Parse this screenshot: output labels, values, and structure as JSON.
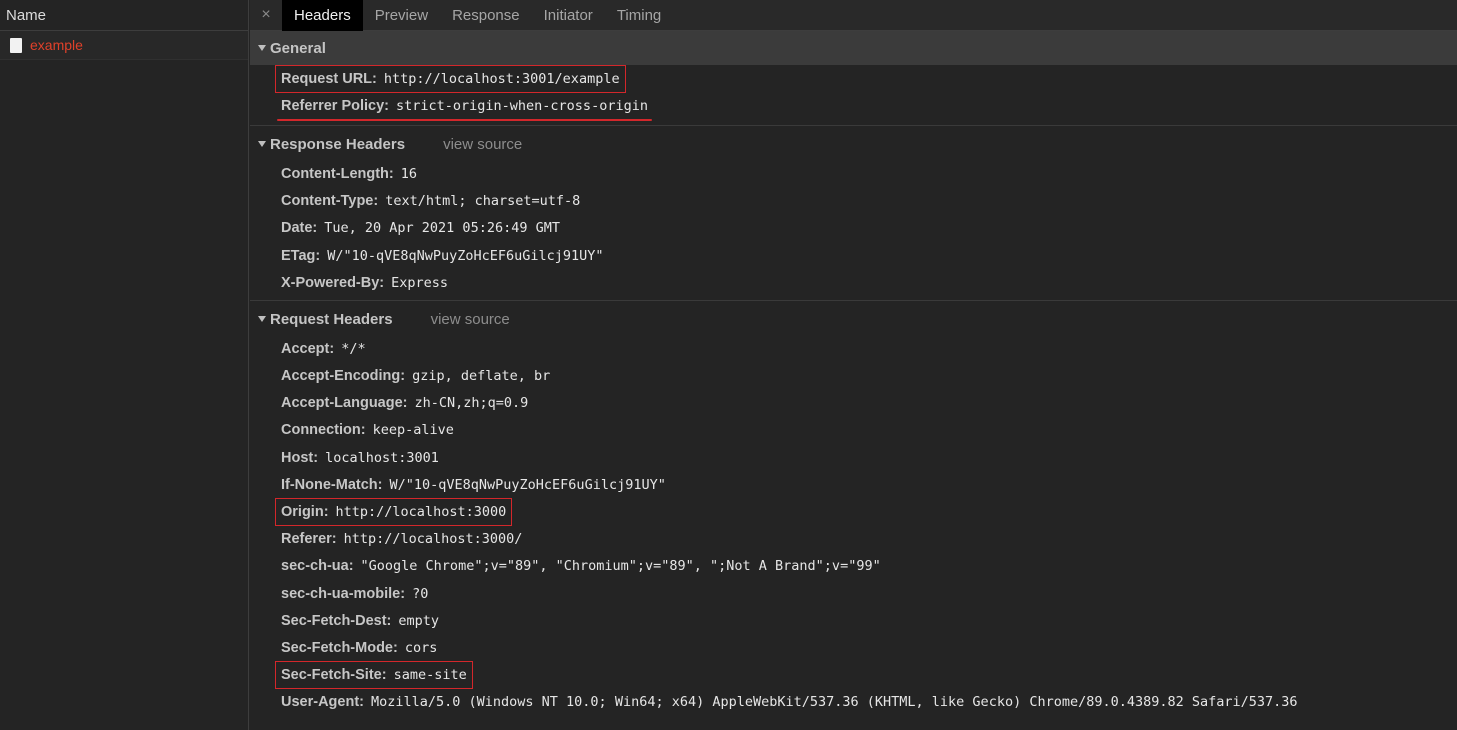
{
  "left_panel": {
    "header": "Name",
    "requests": [
      {
        "name": "example"
      }
    ]
  },
  "tabs": [
    "Headers",
    "Preview",
    "Response",
    "Initiator",
    "Timing"
  ],
  "close_glyph": "×",
  "general": {
    "title": "General",
    "rows": [
      {
        "key": "Request URL:",
        "value": "http://localhost:3001/example"
      },
      {
        "key": "Referrer Policy:",
        "value": "strict-origin-when-cross-origin"
      }
    ]
  },
  "response_headers": {
    "title": "Response Headers",
    "view_source": "view source",
    "rows": [
      {
        "key": "Content-Length:",
        "value": "16"
      },
      {
        "key": "Content-Type:",
        "value": "text/html; charset=utf-8"
      },
      {
        "key": "Date:",
        "value": "Tue, 20 Apr 2021 05:26:49 GMT"
      },
      {
        "key": "ETag:",
        "value": "W/\"10-qVE8qNwPuyZoHcEF6uGilcj91UY\""
      },
      {
        "key": "X-Powered-By:",
        "value": "Express"
      }
    ]
  },
  "request_headers": {
    "title": "Request Headers",
    "view_source": "view source",
    "rows": [
      {
        "key": "Accept:",
        "value": "*/*"
      },
      {
        "key": "Accept-Encoding:",
        "value": "gzip, deflate, br"
      },
      {
        "key": "Accept-Language:",
        "value": "zh-CN,zh;q=0.9"
      },
      {
        "key": "Connection:",
        "value": "keep-alive"
      },
      {
        "key": "Host:",
        "value": "localhost:3001"
      },
      {
        "key": "If-None-Match:",
        "value": "W/\"10-qVE8qNwPuyZoHcEF6uGilcj91UY\""
      },
      {
        "key": "Origin:",
        "value": "http://localhost:3000"
      },
      {
        "key": "Referer:",
        "value": "http://localhost:3000/"
      },
      {
        "key": "sec-ch-ua:",
        "value": "\"Google Chrome\";v=\"89\", \"Chromium\";v=\"89\", \";Not A Brand\";v=\"99\""
      },
      {
        "key": "sec-ch-ua-mobile:",
        "value": "?0"
      },
      {
        "key": "Sec-Fetch-Dest:",
        "value": "empty"
      },
      {
        "key": "Sec-Fetch-Mode:",
        "value": "cors"
      },
      {
        "key": "Sec-Fetch-Site:",
        "value": "same-site"
      },
      {
        "key": "User-Agent:",
        "value": "Mozilla/5.0 (Windows NT 10.0; Win64; x64) AppleWebKit/537.36 (KHTML, like Gecko) Chrome/89.0.4389.82 Safari/537.36"
      }
    ]
  },
  "colors": {
    "background": "#242424",
    "highlight": "#d3272b",
    "request_name": "#e0412a"
  }
}
